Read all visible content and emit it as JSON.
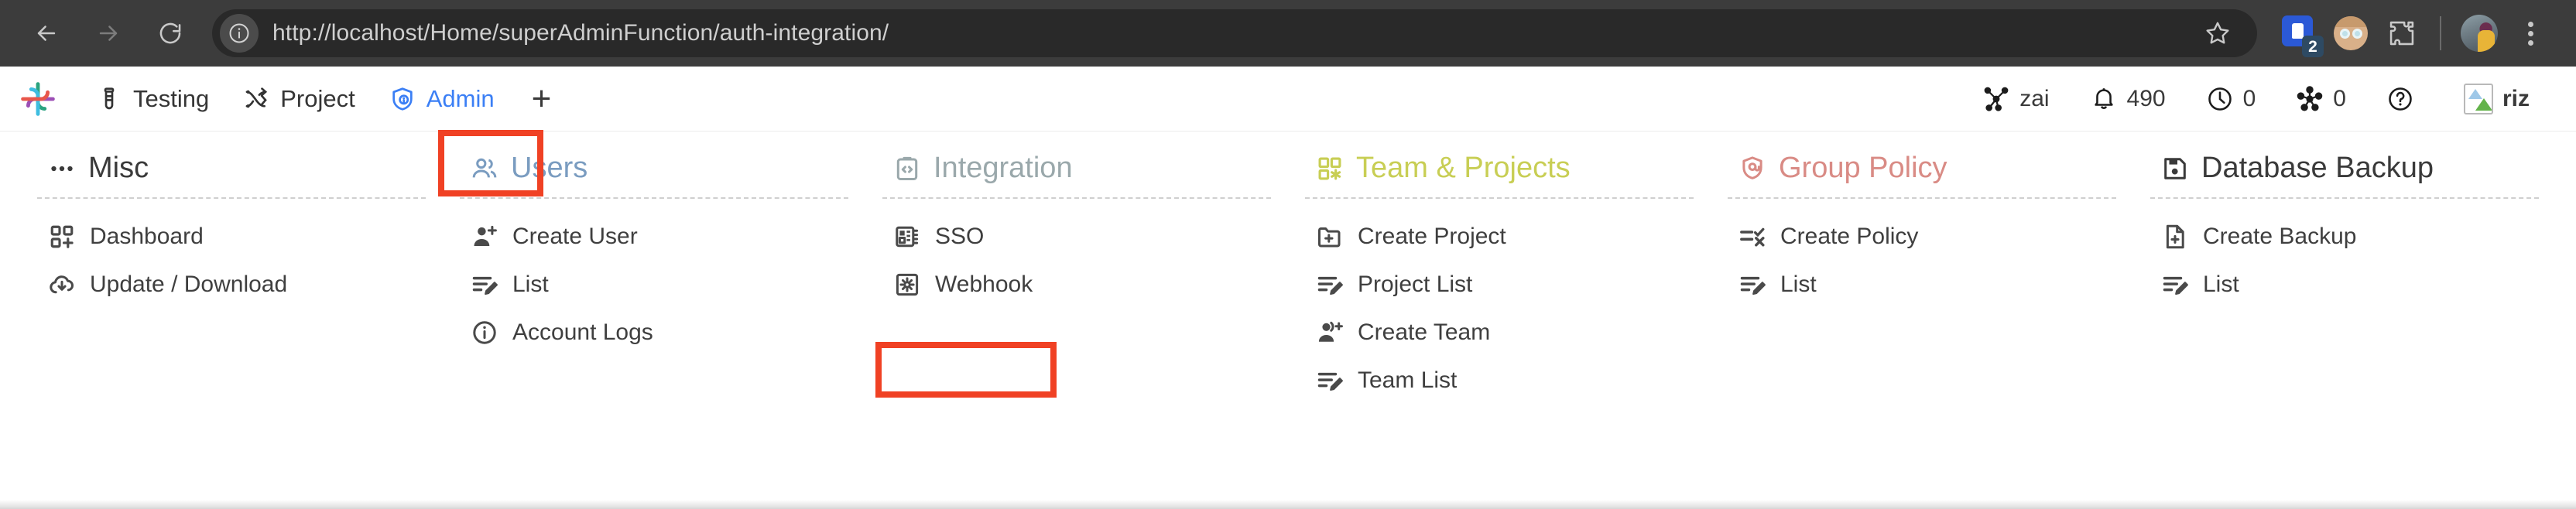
{
  "browser": {
    "back_label": "Back",
    "forward_label": "Forward",
    "reload_label": "Reload",
    "site_info_icon": "info-circle-icon",
    "url": "http://localhost/Home/superAdminFunction/auth-integration/",
    "bookmark_icon": "star-icon",
    "extension_badge_count": "2",
    "extensions_puzzle_icon": "puzzle-piece-icon",
    "menu_icon": "kebab-menu-icon"
  },
  "app_bar": {
    "logo_name": "app-logo",
    "tabs": [
      {
        "label": "Testing",
        "icon": "test-tube-icon",
        "active": false
      },
      {
        "label": "Project",
        "icon": "shuffle-icon",
        "active": false
      },
      {
        "label": "Admin",
        "icon": "shield-user-icon",
        "active": true
      }
    ],
    "add_tab_label": "+",
    "stats": [
      {
        "icon": "network-graph-icon",
        "value": "zai"
      },
      {
        "icon": "bell-icon",
        "value": "490"
      },
      {
        "icon": "clock-icon",
        "value": "0"
      },
      {
        "icon": "share-nodes-icon",
        "value": "0"
      },
      {
        "icon": "help-circle-icon",
        "value": ""
      },
      {
        "icon": "broken-image-icon",
        "value": "riz"
      }
    ]
  },
  "mega_menu": {
    "columns": [
      {
        "title": "Misc",
        "icon": "ellipsis-icon",
        "color": "#3a3a3a",
        "items": [
          {
            "label": "Dashboard",
            "icon": "grid-plus-icon"
          },
          {
            "label": "Update / Download",
            "icon": "cloud-download-icon"
          }
        ]
      },
      {
        "title": "Users",
        "icon": "users-icon",
        "color": "#7a9cc0",
        "items": [
          {
            "label": "Create User",
            "icon": "user-plus-icon"
          },
          {
            "label": "List",
            "icon": "list-edit-icon"
          },
          {
            "label": "Account Logs",
            "icon": "info-circle-icon"
          }
        ]
      },
      {
        "title": "Integration",
        "icon": "code-clipboard-icon",
        "color": "#9aa8ab",
        "items": [
          {
            "label": "SSO",
            "icon": "chip-card-icon",
            "highlighted": true
          },
          {
            "label": "Webhook",
            "icon": "gear-square-icon"
          }
        ]
      },
      {
        "title": "Team & Projects",
        "icon": "grid-dots-icon",
        "color": "#c8ce54",
        "items": [
          {
            "label": "Create Project",
            "icon": "folder-plus-icon"
          },
          {
            "label": "Project List",
            "icon": "list-edit-icon"
          },
          {
            "label": "Create Team",
            "icon": "user-group-plus-icon"
          },
          {
            "label": "Team List",
            "icon": "list-edit-icon"
          }
        ]
      },
      {
        "title": "Group Policy",
        "icon": "shield-at-icon",
        "color": "#d98b85",
        "items": [
          {
            "label": "Create Policy",
            "icon": "list-check-x-icon"
          },
          {
            "label": "List",
            "icon": "list-edit-icon"
          }
        ]
      },
      {
        "title": "Database Backup",
        "icon": "floppy-disk-icon",
        "color": "#3a3a3a",
        "items": [
          {
            "label": "Create Backup",
            "icon": "file-plus-icon"
          },
          {
            "label": "List",
            "icon": "list-edit-icon"
          }
        ]
      }
    ]
  },
  "annotations": {
    "highlight_color": "#f04124",
    "boxes": [
      {
        "target": "admin-tab"
      },
      {
        "target": "menu-item-sso"
      }
    ]
  }
}
